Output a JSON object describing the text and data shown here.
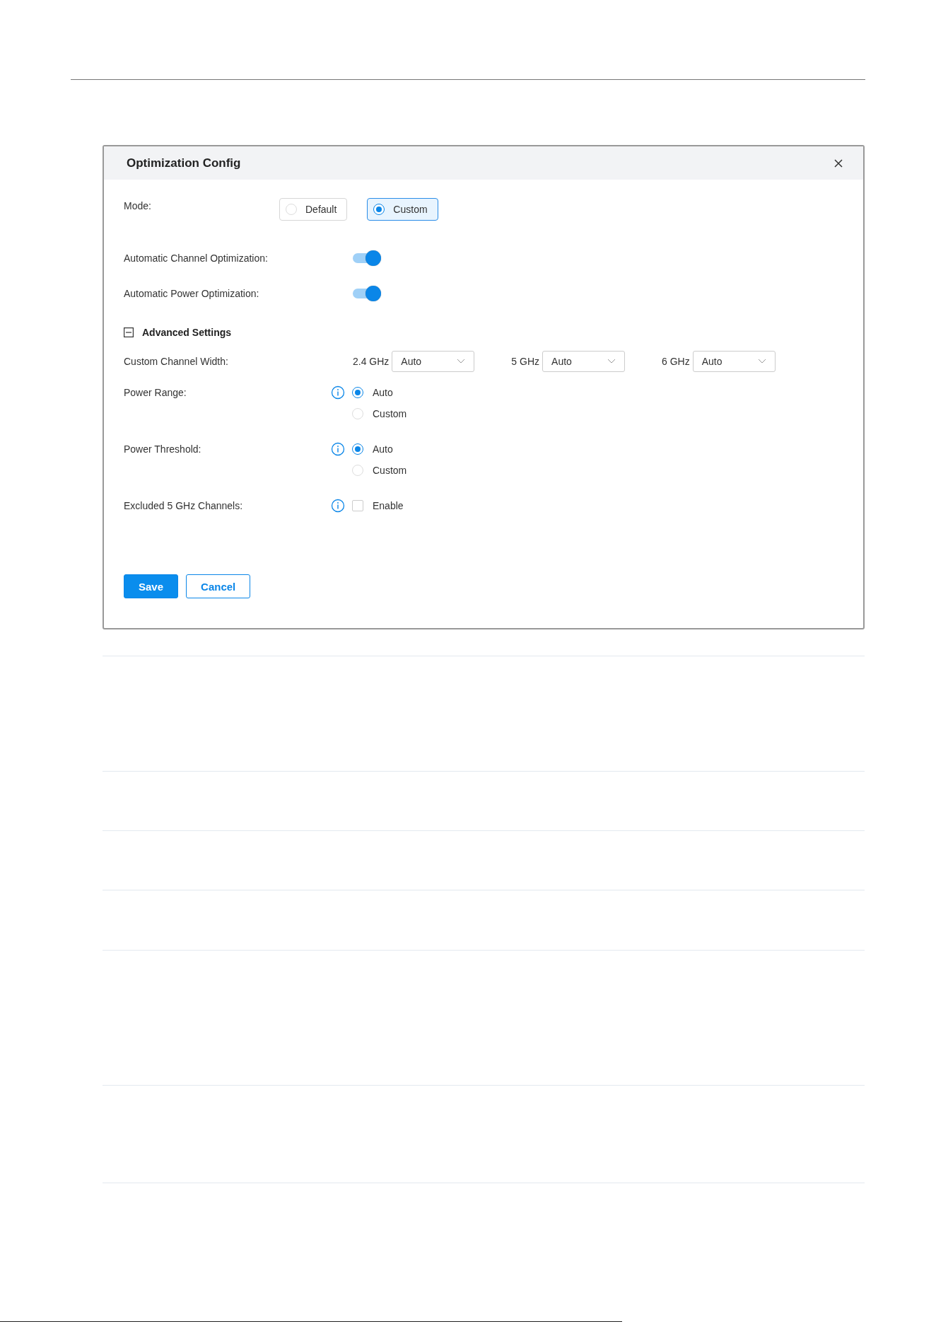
{
  "dialog": {
    "title": "Optimization Config",
    "mode": {
      "label": "Mode:",
      "options": [
        {
          "label": "Default",
          "selected": false
        },
        {
          "label": "Custom",
          "selected": true
        }
      ]
    },
    "toggles": [
      {
        "label": "Automatic Channel Optimization:",
        "on": true
      },
      {
        "label": "Automatic Power Optimization:",
        "on": true
      }
    ],
    "advanced": {
      "label": "Advanced Settings",
      "expanded": true
    },
    "channel_width": {
      "label": "Custom Channel Width:",
      "bands": [
        {
          "band": "2.4 GHz",
          "value": "Auto"
        },
        {
          "band": "5 GHz",
          "value": "Auto"
        },
        {
          "band": "6 GHz",
          "value": "Auto"
        }
      ]
    },
    "radio_groups": [
      {
        "label": "Power Range:",
        "options": [
          {
            "label": "Auto",
            "selected": true
          },
          {
            "label": "Custom",
            "selected": false
          }
        ]
      },
      {
        "label": "Power Threshold:",
        "options": [
          {
            "label": "Auto",
            "selected": true
          },
          {
            "label": "Custom",
            "selected": false
          }
        ]
      }
    ],
    "excluded": {
      "label": "Excluded 5 GHz Channels:",
      "option": "Enable",
      "checked": false
    },
    "buttons": [
      {
        "label": "Save",
        "kind": "primary"
      },
      {
        "label": "Cancel",
        "kind": "secondary"
      }
    ]
  }
}
